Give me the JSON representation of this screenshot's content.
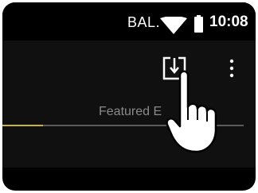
{
  "status_bar": {
    "carrier": "BAL.",
    "time": "10:08",
    "wifi_icon": "wifi-icon",
    "battery_icon": "battery-icon"
  },
  "toolbar": {
    "download_icon": "download-icon",
    "overflow_icon": "more-vertical-icon"
  },
  "tabs": {
    "active_label": "Featured E"
  },
  "overlay": {
    "hand_icon": "tapping-hand-icon"
  },
  "colors": {
    "background": "#000000",
    "app_bar": "#101010",
    "tab_indicator": "#c9b33a",
    "label": "#8a8a8a"
  }
}
